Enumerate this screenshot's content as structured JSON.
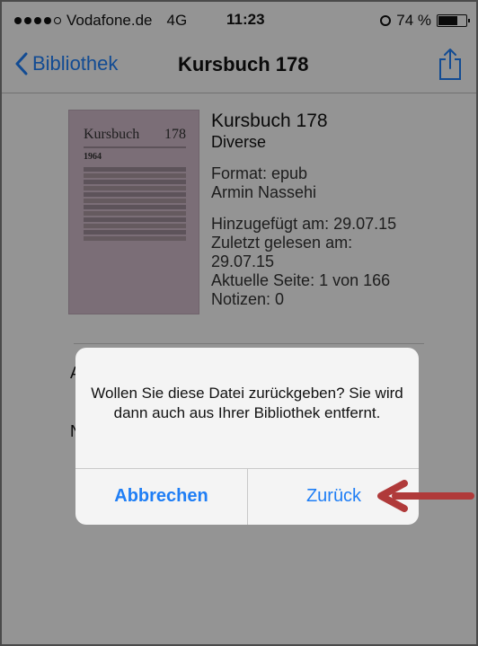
{
  "status_bar": {
    "carrier": "Vodafone.de",
    "network": "4G",
    "time": "11:23",
    "battery": "74 %",
    "battery_level": 0.74,
    "signal_bars_filled": 4,
    "signal_bars_total": 5
  },
  "nav": {
    "back_label": "Bibliothek",
    "title": "Kursbuch 178",
    "icons": {
      "back": "chevron-left-icon",
      "share": "share-icon"
    }
  },
  "book": {
    "cover": {
      "title": "Kursbuch",
      "number": "178",
      "year": "1964"
    },
    "title": "Kursbuch 178",
    "author": "Diverse",
    "format": "Format: epub",
    "contributor": "Armin Nassehi",
    "added": "Hinzugefügt am: 29.07.15",
    "last_read_label": "Zuletzt gelesen am:",
    "last_read_date": "29.07.15",
    "current_page": "Aktuelle Seite: 1 von 166",
    "notes": "Notizen: 0"
  },
  "dialog": {
    "message": "Wollen Sie diese Datei zurückgeben? Sie wird dann auch aus Ihrer Bibliothek entfernt.",
    "cancel_label": "Abbrechen",
    "confirm_label": "Zurück"
  },
  "colors": {
    "accent": "#1f7ef5",
    "annotation_arrow": "#b03a3a"
  }
}
